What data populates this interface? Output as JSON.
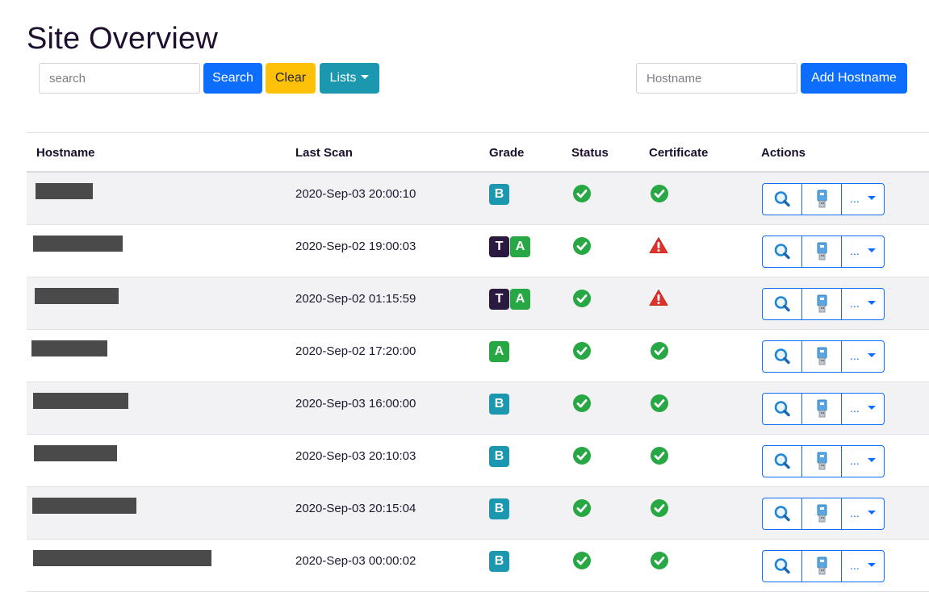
{
  "page": {
    "title": "Site Overview"
  },
  "toolbar": {
    "search_placeholder": "search",
    "search_label": "Search",
    "clear_label": "Clear",
    "lists_label": "Lists",
    "hostname_placeholder": "Hostname",
    "add_hostname_label": "Add Hostname"
  },
  "table": {
    "headers": {
      "hostname": "Hostname",
      "last_scan": "Last Scan",
      "grade": "Grade",
      "status": "Status",
      "certificate": "Certificate",
      "actions": "Actions"
    },
    "rows": [
      {
        "hostname": "[redacted]",
        "last_scan": "2020-Sep-03 20:00:10",
        "grades": [
          "B"
        ],
        "status": "ok",
        "certificate": "ok"
      },
      {
        "hostname": "[redacted]",
        "last_scan": "2020-Sep-02 19:00:03",
        "grades": [
          "T",
          "A"
        ],
        "status": "ok",
        "certificate": "warning"
      },
      {
        "hostname": "[redacted]",
        "last_scan": "2020-Sep-02 01:15:59",
        "grades": [
          "T",
          "A"
        ],
        "status": "ok",
        "certificate": "warning"
      },
      {
        "hostname": "[redacted]",
        "last_scan": "2020-Sep-02 17:20:00",
        "grades": [
          "A"
        ],
        "status": "ok",
        "certificate": "ok"
      },
      {
        "hostname": "[redacted]",
        "last_scan": "2020-Sep-03 16:00:00",
        "grades": [
          "B"
        ],
        "status": "ok",
        "certificate": "ok"
      },
      {
        "hostname": "[redacted]",
        "last_scan": "2020-Sep-03 20:10:03",
        "grades": [
          "B"
        ],
        "status": "ok",
        "certificate": "ok"
      },
      {
        "hostname": "[redacted]",
        "last_scan": "2020-Sep-03 20:15:04",
        "grades": [
          "B"
        ],
        "status": "ok",
        "certificate": "ok"
      },
      {
        "hostname": "[redacted]",
        "last_scan": "2020-Sep-03 00:00:02",
        "grades": [
          "B"
        ],
        "status": "ok",
        "certificate": "ok"
      }
    ],
    "action_icons": [
      "magnifier-icon",
      "usb-key-icon"
    ],
    "more_label": "..."
  },
  "colors": {
    "primary": "#0d6efd",
    "warning": "#ffc107",
    "info": "#1b98b0",
    "grade_a": "#28a745",
    "grade_t": "#2b1a3f",
    "ok": "#28a745",
    "alert": "#e0312a"
  }
}
